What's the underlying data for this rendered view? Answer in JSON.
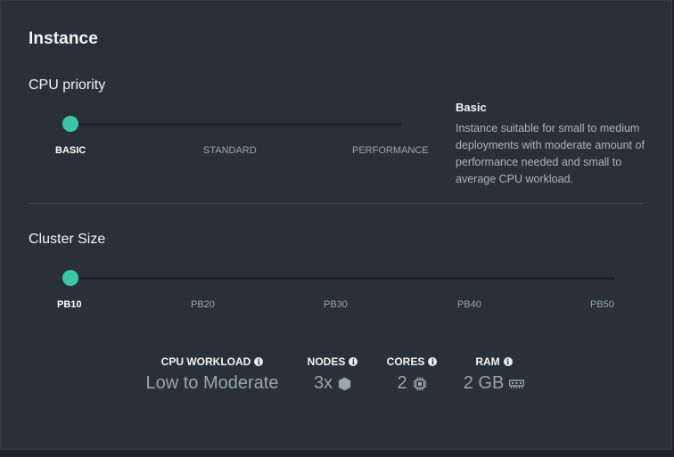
{
  "instance": {
    "title": "Instance"
  },
  "cpu_priority": {
    "title": "CPU priority",
    "options": [
      "BASIC",
      "STANDARD",
      "PERFORMANCE"
    ],
    "selected": "BASIC",
    "description_title": "Basic",
    "description": "Instance suitable for small to medium deployments with moderate amount of performance needed and small to average CPU workload."
  },
  "cluster_size": {
    "title": "Cluster Size",
    "options": [
      "PB10",
      "PB20",
      "PB30",
      "PB40",
      "PB50"
    ],
    "selected": "PB10"
  },
  "stats": {
    "cpu_workload": {
      "label": "CPU WORKLOAD",
      "value": "Low to Moderate"
    },
    "nodes": {
      "label": "NODES",
      "value": "3x",
      "icon": "hexagon-icon"
    },
    "cores": {
      "label": "CORES",
      "value": "2",
      "icon": "cpu-chip-icon"
    },
    "ram": {
      "label": "RAM",
      "value": "2 GB",
      "icon": "memory-icon"
    }
  },
  "colors": {
    "accent": "#3cc6a7",
    "background": "#293037"
  }
}
